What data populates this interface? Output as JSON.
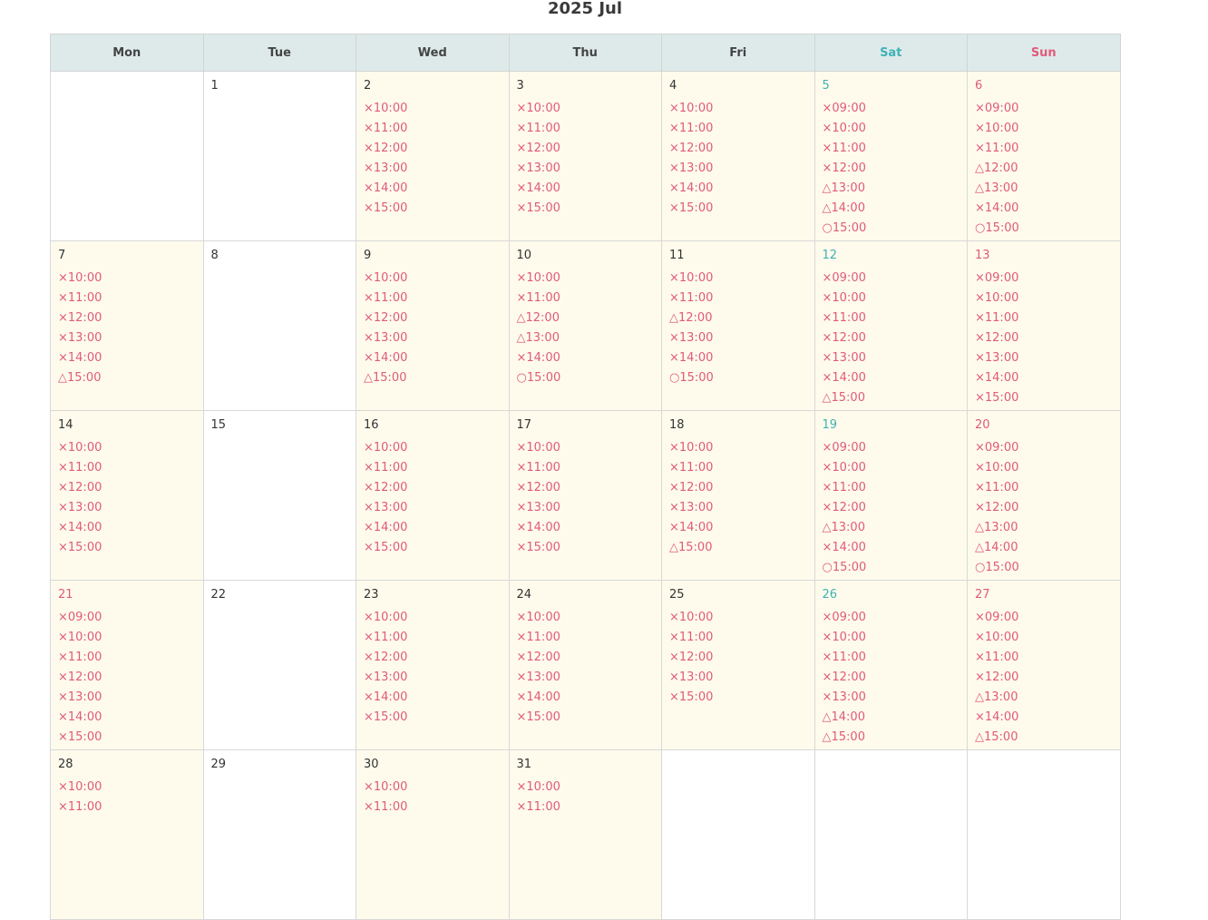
{
  "calendar": {
    "title": "2025 Jul",
    "weekdays": [
      "Mon",
      "Tue",
      "Wed",
      "Thu",
      "Fri",
      "Sat",
      "Sun"
    ],
    "weeks": [
      [
        {
          "day": "",
          "slots": []
        },
        {
          "day": "1",
          "slots": []
        },
        {
          "day": "2",
          "slots": [
            "×10:00",
            "×11:00",
            "×12:00",
            "×13:00",
            "×14:00",
            "×15:00"
          ]
        },
        {
          "day": "3",
          "slots": [
            "×10:00",
            "×11:00",
            "×12:00",
            "×13:00",
            "×14:00",
            "×15:00"
          ]
        },
        {
          "day": "4",
          "slots": [
            "×10:00",
            "×11:00",
            "×12:00",
            "×13:00",
            "×14:00",
            "×15:00"
          ]
        },
        {
          "day": "5",
          "slots": [
            "×09:00",
            "×10:00",
            "×11:00",
            "×12:00",
            "△13:00",
            "△14:00",
            "○15:00"
          ]
        },
        {
          "day": "6",
          "slots": [
            "×09:00",
            "×10:00",
            "×11:00",
            "△12:00",
            "△13:00",
            "×14:00",
            "○15:00"
          ]
        }
      ],
      [
        {
          "day": "7",
          "slots": [
            "×10:00",
            "×11:00",
            "×12:00",
            "×13:00",
            "×14:00",
            "△15:00"
          ]
        },
        {
          "day": "8",
          "slots": []
        },
        {
          "day": "9",
          "slots": [
            "×10:00",
            "×11:00",
            "×12:00",
            "×13:00",
            "×14:00",
            "△15:00"
          ]
        },
        {
          "day": "10",
          "slots": [
            "×10:00",
            "×11:00",
            "△12:00",
            "△13:00",
            "×14:00",
            "○15:00"
          ]
        },
        {
          "day": "11",
          "slots": [
            "×10:00",
            "×11:00",
            "△12:00",
            "×13:00",
            "×14:00",
            "○15:00"
          ]
        },
        {
          "day": "12",
          "slots": [
            "×09:00",
            "×10:00",
            "×11:00",
            "×12:00",
            "×13:00",
            "×14:00",
            "△15:00"
          ]
        },
        {
          "day": "13",
          "slots": [
            "×09:00",
            "×10:00",
            "×11:00",
            "×12:00",
            "×13:00",
            "×14:00",
            "×15:00"
          ]
        }
      ],
      [
        {
          "day": "14",
          "slots": [
            "×10:00",
            "×11:00",
            "×12:00",
            "×13:00",
            "×14:00",
            "×15:00"
          ]
        },
        {
          "day": "15",
          "slots": []
        },
        {
          "day": "16",
          "slots": [
            "×10:00",
            "×11:00",
            "×12:00",
            "×13:00",
            "×14:00",
            "×15:00"
          ]
        },
        {
          "day": "17",
          "slots": [
            "×10:00",
            "×11:00",
            "×12:00",
            "×13:00",
            "×14:00",
            "×15:00"
          ]
        },
        {
          "day": "18",
          "slots": [
            "×10:00",
            "×11:00",
            "×12:00",
            "×13:00",
            "×14:00",
            "△15:00"
          ]
        },
        {
          "day": "19",
          "slots": [
            "×09:00",
            "×10:00",
            "×11:00",
            "×12:00",
            "△13:00",
            "×14:00",
            "○15:00"
          ]
        },
        {
          "day": "20",
          "slots": [
            "×09:00",
            "×10:00",
            "×11:00",
            "×12:00",
            "△13:00",
            "△14:00",
            "○15:00"
          ]
        }
      ],
      [
        {
          "day": "21",
          "slots": [
            "×09:00",
            "×10:00",
            "×11:00",
            "×12:00",
            "×13:00",
            "×14:00",
            "×15:00"
          ]
        },
        {
          "day": "22",
          "slots": []
        },
        {
          "day": "23",
          "slots": [
            "×10:00",
            "×11:00",
            "×12:00",
            "×13:00",
            "×14:00",
            "×15:00"
          ]
        },
        {
          "day": "24",
          "slots": [
            "×10:00",
            "×11:00",
            "×12:00",
            "×13:00",
            "×14:00",
            "×15:00"
          ]
        },
        {
          "day": "25",
          "slots": [
            "×10:00",
            "×11:00",
            "×12:00",
            "×13:00",
            "×15:00"
          ]
        },
        {
          "day": "26",
          "slots": [
            "×09:00",
            "×10:00",
            "×11:00",
            "×12:00",
            "×13:00",
            "△14:00",
            "△15:00"
          ]
        },
        {
          "day": "27",
          "slots": [
            "×09:00",
            "×10:00",
            "×11:00",
            "×12:00",
            "△13:00",
            "×14:00",
            "△15:00"
          ]
        }
      ],
      [
        {
          "day": "28",
          "slots": [
            "×10:00",
            "×11:00"
          ]
        },
        {
          "day": "29",
          "slots": []
        },
        {
          "day": "30",
          "slots": [
            "×10:00",
            "×11:00"
          ]
        },
        {
          "day": "31",
          "slots": [
            "×10:00",
            "×11:00"
          ]
        },
        {
          "day": "",
          "slots": []
        },
        {
          "day": "",
          "slots": []
        },
        {
          "day": "",
          "slots": []
        }
      ]
    ]
  },
  "colors": {
    "header_bg": "#deeaea",
    "available_bg": "#fefbec",
    "saturday": "#3eb1b6",
    "sunday_holiday": "#e05a7c",
    "slot_text": "#e05a7c"
  }
}
